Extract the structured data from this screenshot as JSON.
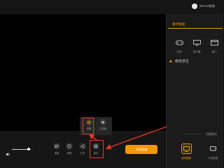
{
  "user": {
    "name": "whine站站",
    "avatar_icon": "avatar-icon"
  },
  "panel": {
    "tab_label": "素材管理",
    "sources": [
      {
        "label": "游戏",
        "icon": "gamepad-icon"
      },
      {
        "label": "显示器",
        "icon": "monitor-icon"
      },
      {
        "label": "窗口",
        "icon": "window-icon"
      }
    ],
    "scene_name": "绝地求生",
    "switch_mode_label": "切换模式",
    "modes": [
      {
        "label": "游戏直播",
        "icon": "tv-icon",
        "active": true
      },
      {
        "label": "手游直播",
        "icon": "phone-icon",
        "active": false
      }
    ]
  },
  "bottom": {
    "volume_icon": "speaker-icon",
    "volume_level": 0.8,
    "tools": [
      {
        "label": "弹幕",
        "icon": "bullet-chat-icon"
      },
      {
        "label": "屏蔽",
        "icon": "shield-icon"
      },
      {
        "label": "分享",
        "icon": "share-icon"
      },
      {
        "label": "更多",
        "icon": "grid-icon"
      }
    ],
    "popup_items": [
      {
        "label": "设置",
        "icon": "settings-icon"
      },
      {
        "label": "工具箱",
        "icon": "toolbox-icon"
      }
    ],
    "start_label": "开始直播"
  },
  "colors": {
    "accent": "#f39800",
    "highlight": "#e8352a",
    "bg": "#141414"
  }
}
